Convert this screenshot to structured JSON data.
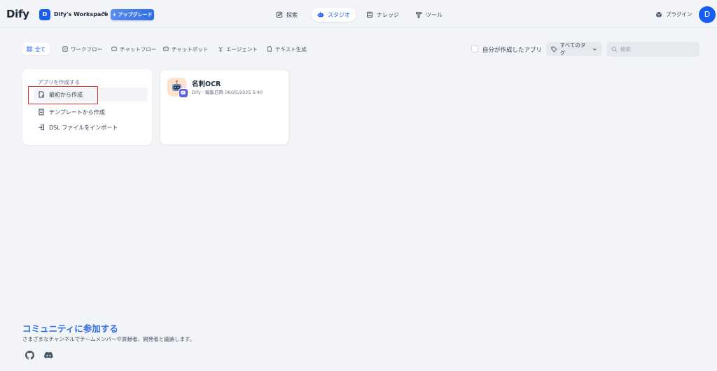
{
  "app": {
    "logo_text": "Dify"
  },
  "workspace": {
    "avatar_letter": "D",
    "name": "Dify's Workspace",
    "upgrade_label": "+ アップグレード"
  },
  "nav": {
    "items": [
      {
        "label": "探索",
        "icon": "explore-icon"
      },
      {
        "label": "スタジオ",
        "icon": "robot-icon",
        "active": true
      },
      {
        "label": "ナレッジ",
        "icon": "book-icon"
      },
      {
        "label": "ツール",
        "icon": "hammer-icon"
      }
    ],
    "plugin_label": "プラグイン",
    "user_avatar_letter": "D"
  },
  "filters": {
    "tabs": [
      {
        "label": "全て",
        "active": true
      },
      {
        "label": "ワークフロー"
      },
      {
        "label": "チャットフロー"
      },
      {
        "label": "チャットボット"
      },
      {
        "label": "エージェント"
      },
      {
        "label": "テキスト生成"
      }
    ],
    "mine_label": "自分が作成したアプリ",
    "tag_label": "すべてのタグ",
    "search_placeholder": "検索"
  },
  "create": {
    "title": "アプリを作成する",
    "items": [
      {
        "label": "最初から作成"
      },
      {
        "label": "テンプレートから作成"
      },
      {
        "label": "DSL ファイルをインポート"
      }
    ]
  },
  "apps": [
    {
      "name": "名刺OCR",
      "meta": "Dify · 編集日時 06/25/2025 5:40"
    }
  ],
  "community": {
    "title": "コミュニティに参加する",
    "subtitle": "さまざまなチャンネルでチームメンバーや貢献者、開発者と議論します。",
    "links": [
      "github-icon",
      "discord-icon"
    ]
  },
  "colors": {
    "accent": "#155eef",
    "background": "#f2f4f7",
    "highlight": "#e02c2c"
  }
}
